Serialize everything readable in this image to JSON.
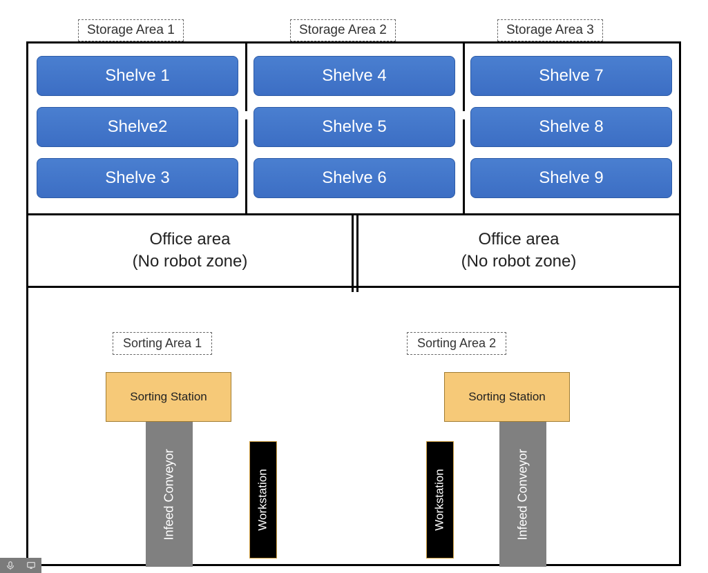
{
  "storage_labels": [
    "Storage Area 1",
    "Storage Area 2",
    "Storage Area 3"
  ],
  "shelves": {
    "col1": [
      "Shelve 1",
      "Shelve2",
      "Shelve 3"
    ],
    "col2": [
      "Shelve 4",
      "Shelve 5",
      "Shelve 6"
    ],
    "col3": [
      "Shelve 7",
      "Shelve 8",
      "Shelve 9"
    ]
  },
  "office": {
    "left_line1": "Office area",
    "left_line2": "(No robot zone)",
    "right_line1": "Office area",
    "right_line2": "(No robot zone)"
  },
  "sorting": {
    "labels": [
      "Sorting Area 1",
      "Sorting Area 2"
    ],
    "station_label": "Sorting Station",
    "infeed_label": "Infeed Conveyor",
    "workstation_label": "Workstation"
  },
  "colors": {
    "shelve_blue": "#3c6ec4",
    "station_orange": "#f6c978",
    "conveyor_gray": "#808080",
    "workstation_black": "#000000"
  }
}
